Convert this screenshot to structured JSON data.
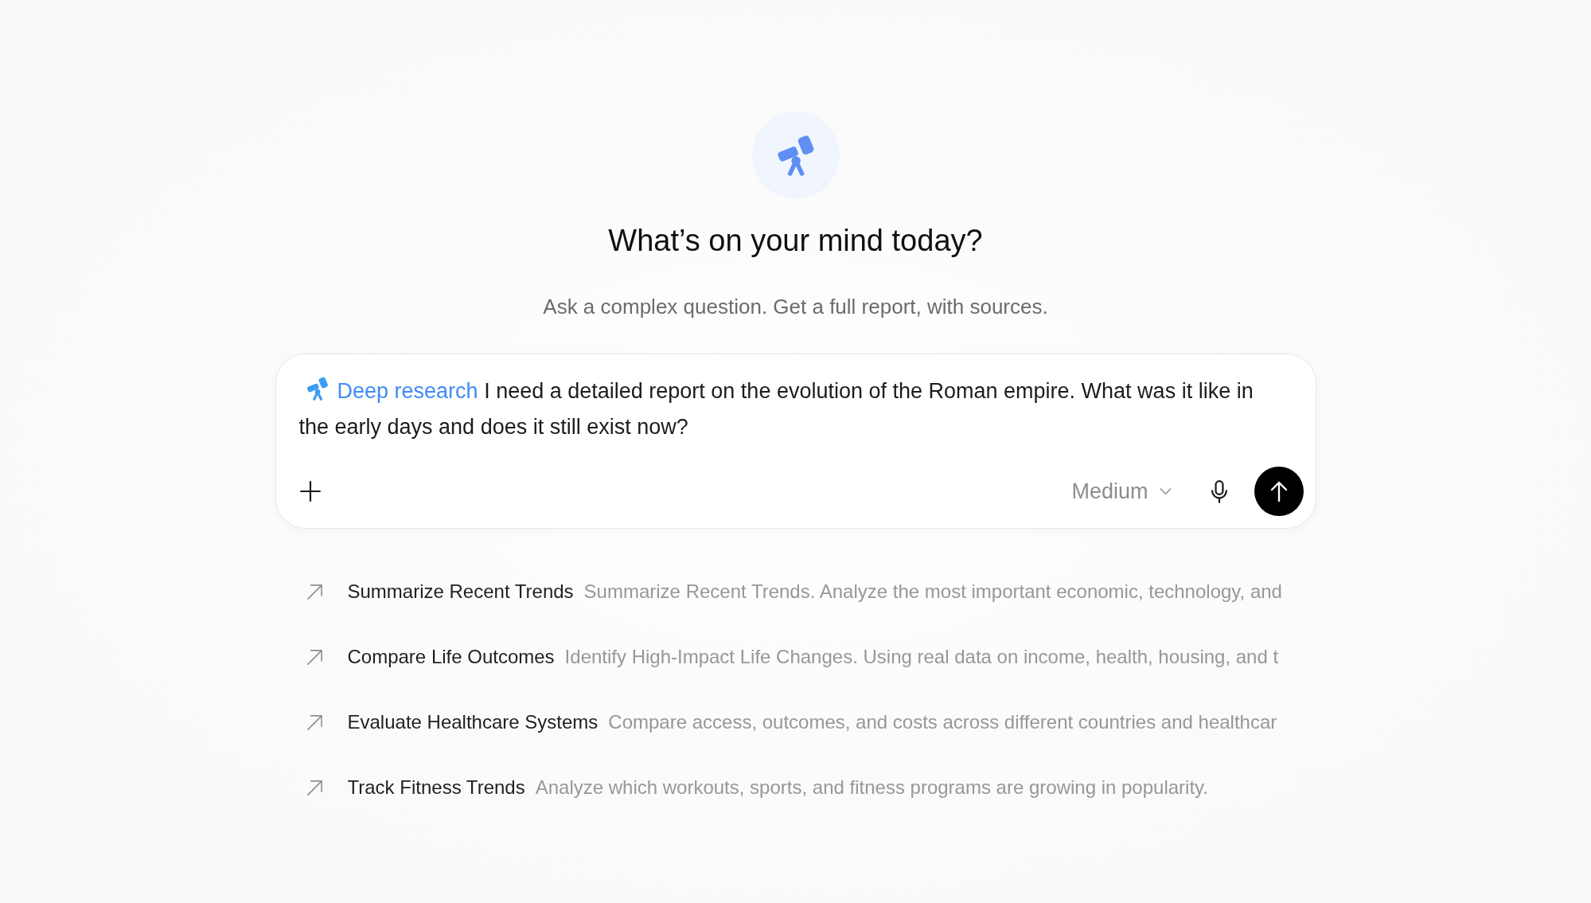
{
  "hero": {
    "title": "What’s on your mind today?",
    "subtitle": "Ask a complex question. Get a full report, with sources."
  },
  "composer": {
    "mode_tag": "Deep research",
    "value": "I need a detailed report on the evolution of the Roman empire. What was it like in the early days and does it still exist now?",
    "effort_select": "Medium"
  },
  "suggestions": [
    {
      "title": "Summarize Recent Trends",
      "description": "Summarize Recent Trends. Analyze the most important economic, technology, and"
    },
    {
      "title": "Compare Life Outcomes",
      "description": "Identify High-Impact Life Changes. Using real data on income, health, housing, and t"
    },
    {
      "title": "Evaluate Healthcare Systems",
      "description": "Compare access, outcomes, and costs across different countries and healthcar"
    },
    {
      "title": "Track Fitness Trends",
      "description": "Analyze which workouts, sports, and fitness programs are growing in popularity."
    }
  ]
}
